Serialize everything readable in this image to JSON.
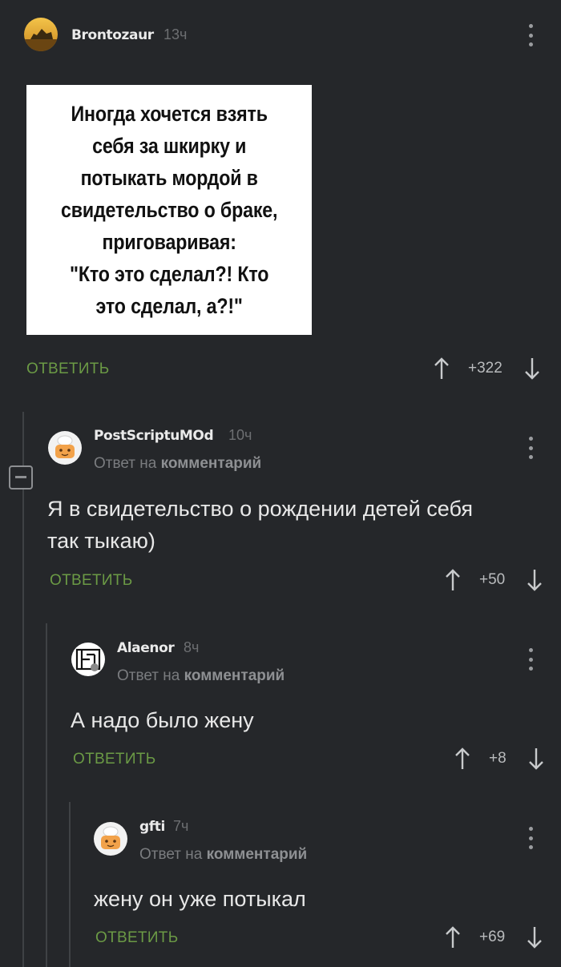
{
  "post": {
    "author": "Brontozaur",
    "time": "13ч",
    "image_text": "Иногда хочется взять\nсебя за шкирку и\nпотыкать мордой в\nсвидетельство о браке,\nприговаривая:\n\"Кто это сделал?! Кто\nэто сделал, а?!\"",
    "reply_label": "ОТВЕТИТЬ",
    "score": "+322"
  },
  "comments": [
    {
      "author": "PostScriptuMOd",
      "time": "10ч",
      "reply_prefix": "Ответ на",
      "reply_target": "комментарий",
      "text_line1": "Я в свидетельство о рождении детей себя",
      "text_line2": "так тыкаю)",
      "reply_label": "ОТВЕТИТЬ",
      "score": "+50"
    },
    {
      "author": "Alaenor",
      "time": "8ч",
      "reply_prefix": "Ответ на",
      "reply_target": "комментарий",
      "text_line1": "А надо было жену",
      "reply_label": "ОТВЕТИТЬ",
      "score": "+8"
    },
    {
      "author": "gfti",
      "time": "7ч",
      "reply_prefix": "Ответ на",
      "reply_target": "комментарий",
      "text_line1": "жену он уже потыкал",
      "reply_label": "ОТВЕТИТЬ",
      "score": "+69"
    }
  ],
  "icons": {
    "upvote": "arrow-up-icon",
    "downvote": "arrow-down-icon",
    "menu": "more-vertical-icon",
    "collapse": "minus-square-icon"
  },
  "colors": {
    "background": "#25272a",
    "reply_green": "#6b9a45",
    "text": "#e8e8e8",
    "muted": "#7a7c7f"
  }
}
